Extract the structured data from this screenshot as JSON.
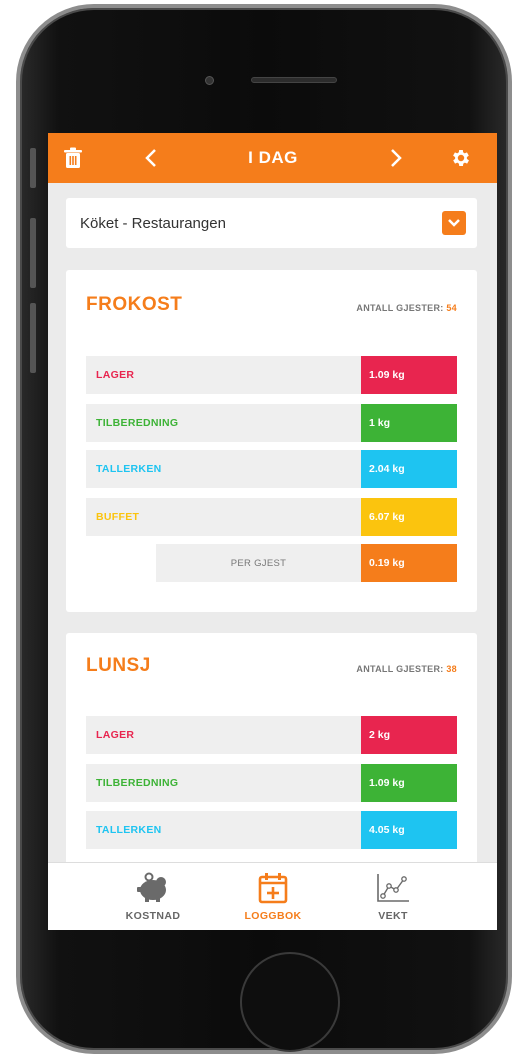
{
  "topbar": {
    "title": "I DAG",
    "left_icon": "trash-icon",
    "prev_icon": "chevron-left-icon",
    "next_icon": "chevron-right-icon",
    "settings_icon": "gear-icon",
    "color": "#f57d1b"
  },
  "selector": {
    "value": "Köket - Restaurangen",
    "dropdown_icon": "chevron-down-icon"
  },
  "meals": [
    {
      "title": "FROKOST",
      "guests_label": "ANTALL GJESTER:",
      "guests_value": "54",
      "rows": [
        {
          "label": "LAGER",
          "value": "1.09 kg",
          "color": "#e8254f"
        },
        {
          "label": "TILBEREDNING",
          "value": "1 kg",
          "color": "#3db336"
        },
        {
          "label": "TALLERKEN",
          "value": "2.04 kg",
          "color": "#1ec4f1"
        },
        {
          "label": "BUFFET",
          "value": "6.07 kg",
          "color": "#fbc40e"
        }
      ],
      "per_guest": {
        "label": "PER GJEST",
        "value": "0.19 kg",
        "color": "#f57d1b"
      }
    },
    {
      "title": "LUNSJ",
      "guests_label": "ANTALL GJESTER:",
      "guests_value": "38",
      "rows": [
        {
          "label": "LAGER",
          "value": "2 kg",
          "color": "#e8254f"
        },
        {
          "label": "TILBEREDNING",
          "value": "1.09 kg",
          "color": "#3db336"
        },
        {
          "label": "TALLERKEN",
          "value": "4.05 kg",
          "color": "#1ec4f1"
        }
      ]
    }
  ],
  "tabs": [
    {
      "label": "KOSTNAD",
      "icon": "piggy-bank-icon",
      "active": false
    },
    {
      "label": "LOGGBOK",
      "icon": "calendar-plus-icon",
      "active": true
    },
    {
      "label": "VEKT",
      "icon": "line-chart-icon",
      "active": false
    }
  ],
  "colors": {
    "accent": "#f57d1b",
    "inactive_tab": "#666666"
  }
}
